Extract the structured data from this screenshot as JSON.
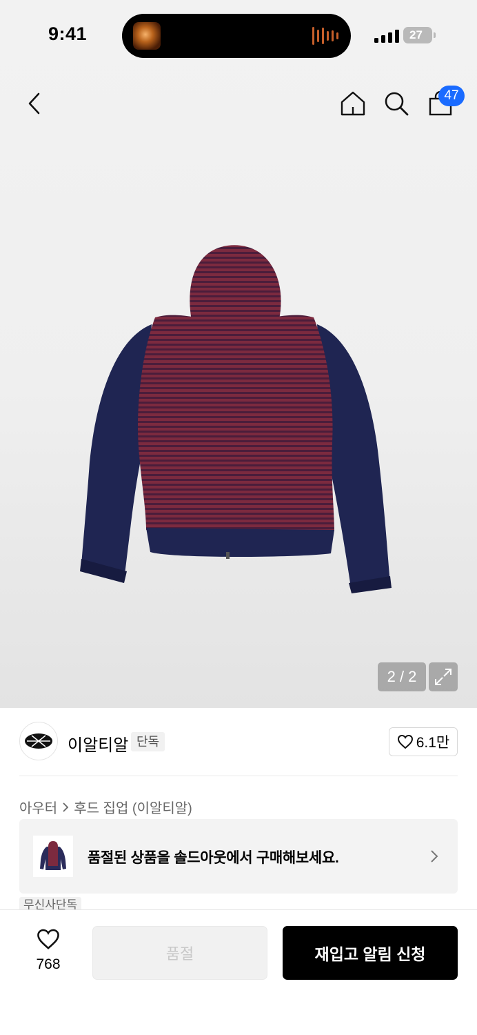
{
  "status_bar": {
    "time": "9:41",
    "battery_level": "27",
    "icons": [
      "now-playing-artwork",
      "audio-waveform-icon",
      "cellular-signal-icon",
      "battery-icon"
    ]
  },
  "nav": {
    "icons": [
      "back-chevron-icon",
      "home-icon",
      "search-icon",
      "shopping-bag-icon"
    ],
    "cart_count": "47"
  },
  "gallery": {
    "counter": "2 / 2",
    "expand_icon": "expand-arrows-icon",
    "product_colors": {
      "body": "#7c2a3f",
      "stripe": "#4b1d3b",
      "sleeves": "#1f2552"
    }
  },
  "brand": {
    "name": "이알티알",
    "tag": "단독",
    "likes": "6.1만",
    "logo_icon": "brand-logo-emblem"
  },
  "breadcrumb": {
    "category": "아우터",
    "subcategory": "후드 집업 (이알티알)"
  },
  "soldout_banner": {
    "text": "품절된 상품을 솔드아웃에서 구매해보세요."
  },
  "exclusive_tag": "무신사단독",
  "bottom_bar": {
    "wish_count": "768",
    "soldout_label": "품절",
    "restock_label": "재입고 알림 신청"
  },
  "colors": {
    "accent_badge": "#1a6bff",
    "primary_button": "#000000",
    "disabled_button": "#f1f1f1"
  }
}
